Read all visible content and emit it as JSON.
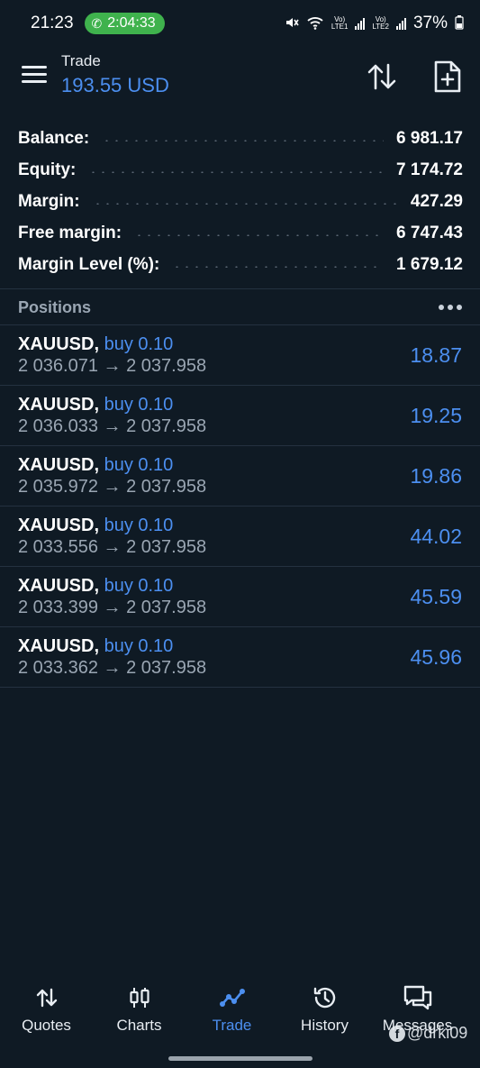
{
  "status_bar": {
    "time": "21:23",
    "call_timer": "2:04:33",
    "battery": "37%",
    "sim1_label": "LTE1",
    "sim2_label": "LTE2"
  },
  "header": {
    "title": "Trade",
    "subtitle": "193.55 USD"
  },
  "summary": [
    {
      "label": "Balance:",
      "value": "6 981.17"
    },
    {
      "label": "Equity:",
      "value": "7 174.72"
    },
    {
      "label": "Margin:",
      "value": "427.29"
    },
    {
      "label": "Free margin:",
      "value": "6 747.43"
    },
    {
      "label": "Margin Level (%):",
      "value": "1 679.12"
    }
  ],
  "positions": {
    "title": "Positions",
    "items": [
      {
        "symbol": "XAUUSD,",
        "side": "buy 0.10",
        "prices": "2 036.071 → 2 037.958",
        "profit": "18.87"
      },
      {
        "symbol": "XAUUSD,",
        "side": "buy 0.10",
        "prices": "2 036.033 → 2 037.958",
        "profit": "19.25"
      },
      {
        "symbol": "XAUUSD,",
        "side": "buy 0.10",
        "prices": "2 035.972 → 2 037.958",
        "profit": "19.86"
      },
      {
        "symbol": "XAUUSD,",
        "side": "buy 0.10",
        "prices": "2 033.556 → 2 037.958",
        "profit": "44.02"
      },
      {
        "symbol": "XAUUSD,",
        "side": "buy 0.10",
        "prices": "2 033.399 → 2 037.958",
        "profit": "45.59"
      },
      {
        "symbol": "XAUUSD,",
        "side": "buy 0.10",
        "prices": "2 033.362 → 2 037.958",
        "profit": "45.96"
      }
    ]
  },
  "bottom_nav": [
    {
      "label": "Quotes",
      "icon": "quotes-arrows-icon"
    },
    {
      "label": "Charts",
      "icon": "candlestick-icon"
    },
    {
      "label": "Trade",
      "icon": "trend-line-icon",
      "active": true
    },
    {
      "label": "History",
      "icon": "history-clock-icon"
    },
    {
      "label": "Messages",
      "icon": "chat-bubbles-icon"
    }
  ],
  "watermark": "@drki09",
  "colors": {
    "background": "#0f1a24",
    "accent": "#4c8ff0",
    "muted_text": "#9aa6b3",
    "call_pill": "#3fb24d"
  }
}
